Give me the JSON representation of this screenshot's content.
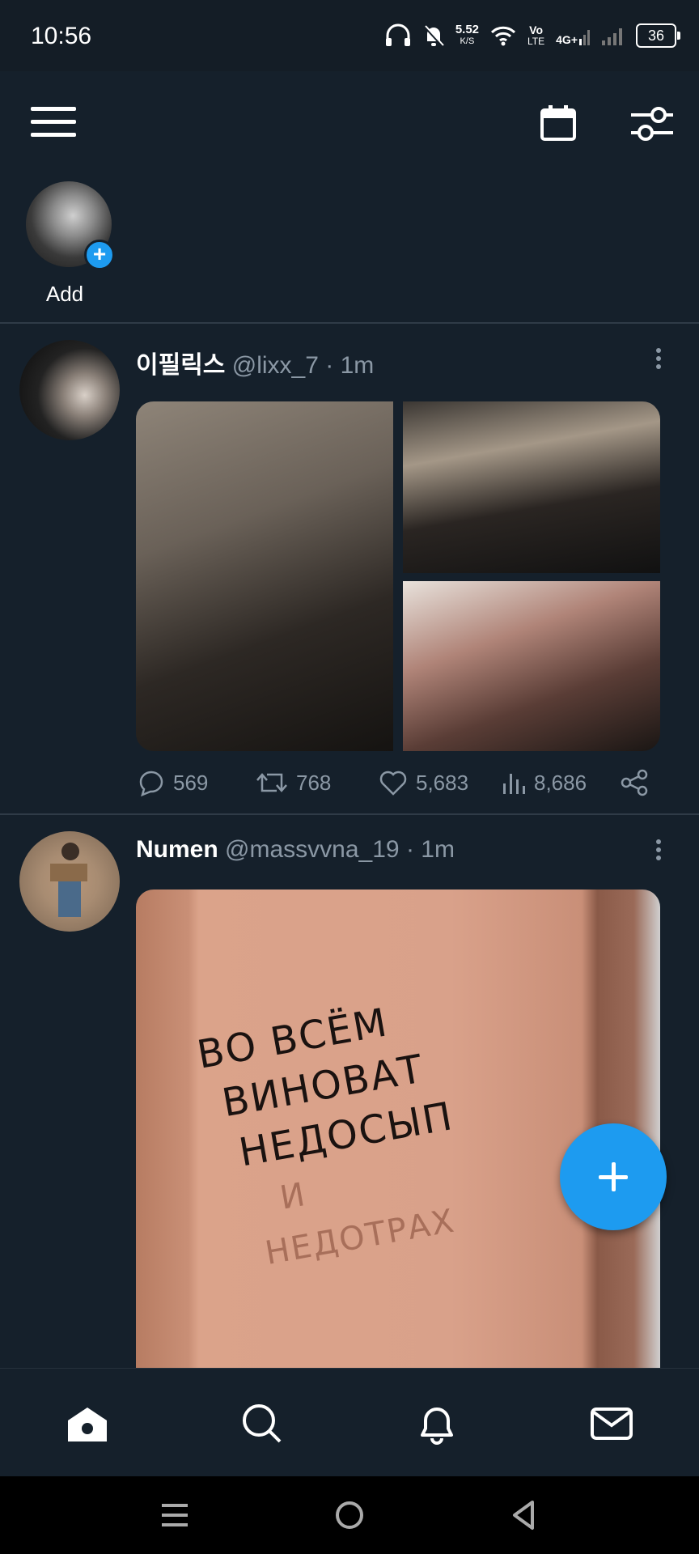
{
  "status_bar": {
    "time": "10:56",
    "net_speed": "5.52",
    "net_speed_unit": "K/S",
    "volte": "Vo",
    "volte_sub": "LTE",
    "network": "4G+",
    "battery": "36"
  },
  "fleets": {
    "add_label": "Add"
  },
  "tweets": [
    {
      "name": "이필릭스",
      "handle": "@lixx_7",
      "time": "· 1m",
      "replies": "569",
      "retweets": "768",
      "likes": "5,683",
      "views": "8,686"
    },
    {
      "name": "Numen",
      "handle": "@massvvna_19",
      "time": "· 1m",
      "image_text": [
        "ВО ВСЁМ",
        "ВИНОВАТ",
        "НЕДОСЫП",
        "И",
        "НЕДОТРАХ"
      ]
    }
  ],
  "colors": {
    "background": "#15202b",
    "accent": "#1d9bf0",
    "muted": "#8b98a5"
  },
  "icons": {
    "header": [
      "menu-icon",
      "calendar-icon",
      "filter-icon"
    ],
    "bottom_nav": [
      "home-icon",
      "search-icon",
      "bell-icon",
      "mail-icon"
    ],
    "system_nav": [
      "recents-icon",
      "home-circle-icon",
      "back-icon"
    ]
  }
}
